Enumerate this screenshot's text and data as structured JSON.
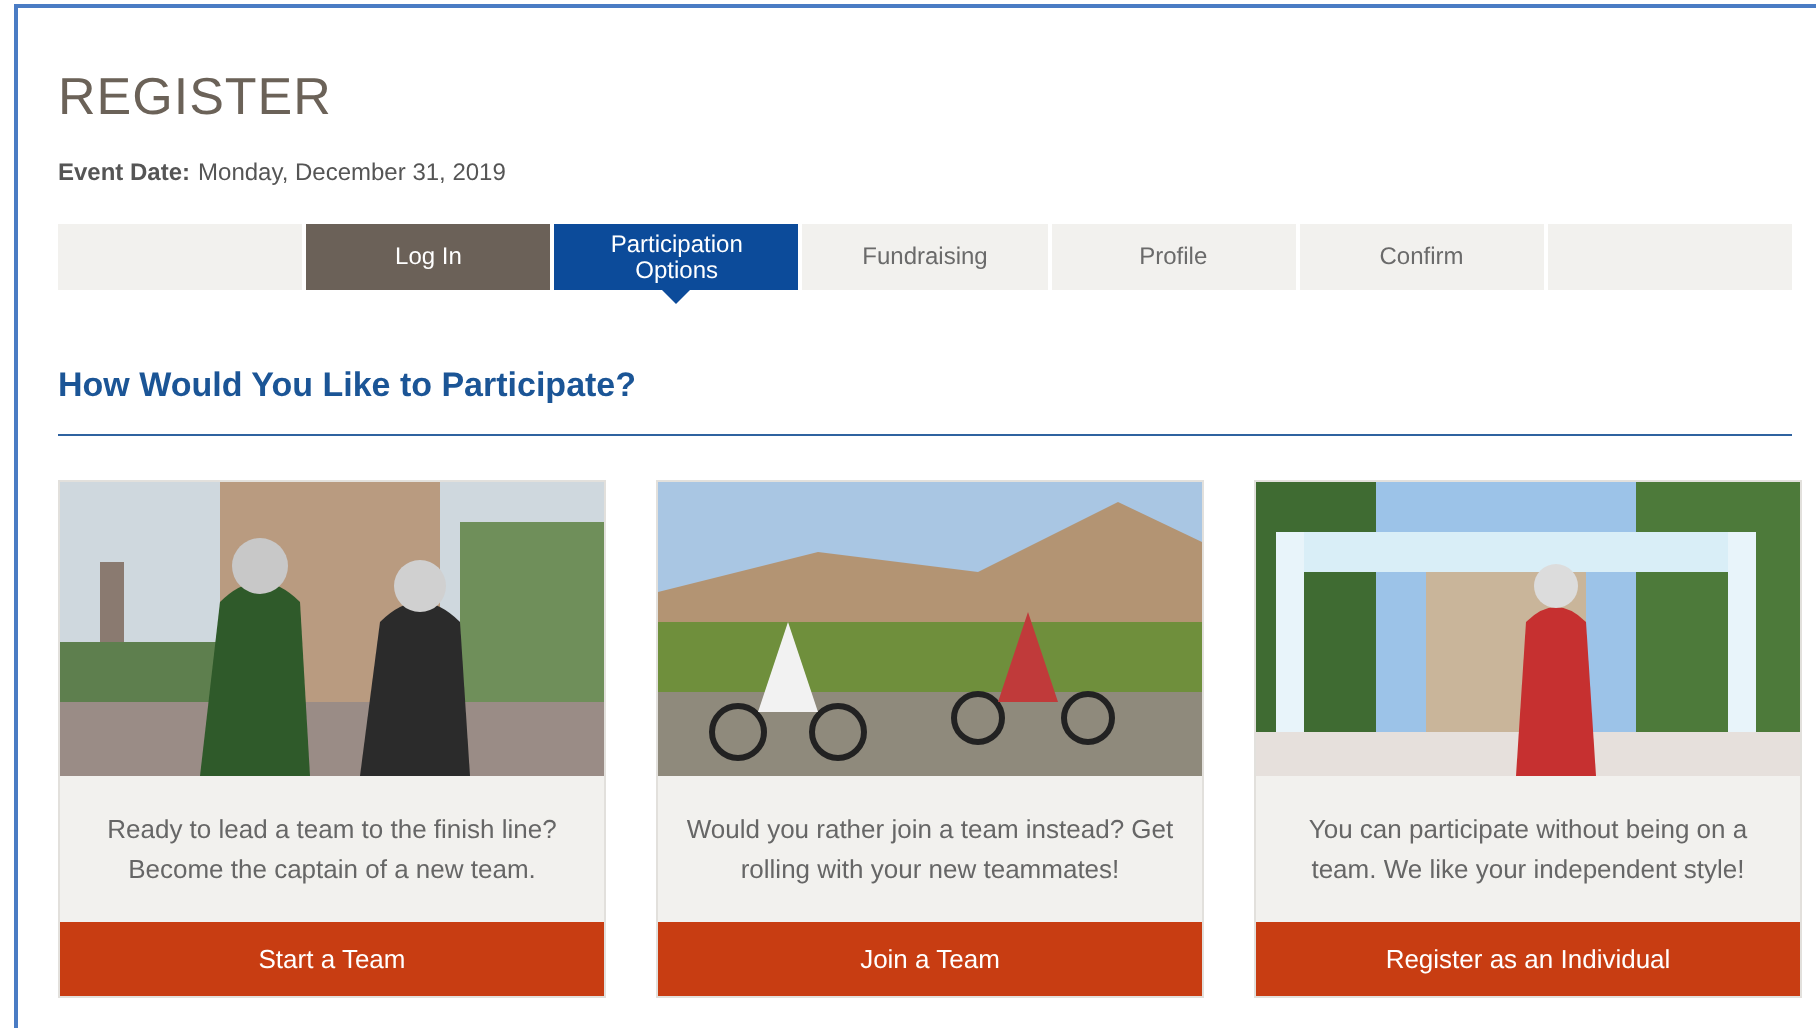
{
  "page": {
    "title": "REGISTER",
    "event_date_label": "Event Date:",
    "event_date": "Monday, December 31, 2019"
  },
  "steps": [
    {
      "kind": "spacer"
    },
    {
      "kind": "step",
      "label": "Log In",
      "selected": false,
      "done": true
    },
    {
      "kind": "step",
      "label": "Participation Options",
      "selected": true,
      "done": false
    },
    {
      "kind": "step",
      "label": "Fundraising",
      "selected": false,
      "done": false
    },
    {
      "kind": "step",
      "label": "Profile",
      "selected": false,
      "done": false
    },
    {
      "kind": "step",
      "label": "Confirm",
      "selected": false,
      "done": false
    },
    {
      "kind": "spacer"
    }
  ],
  "section": {
    "heading": "How Would You Like to Participate?"
  },
  "options": [
    {
      "text": "Ready to lead a team to the finish line? Become the captain of a new team.",
      "button": "Start a Team"
    },
    {
      "text": "Would you rather join a team instead? Get rolling with your new teammates!",
      "button": "Join a Team"
    },
    {
      "text": "You can participate without being on a team. We like your independent style!",
      "button": "Register as an Individual"
    }
  ]
}
